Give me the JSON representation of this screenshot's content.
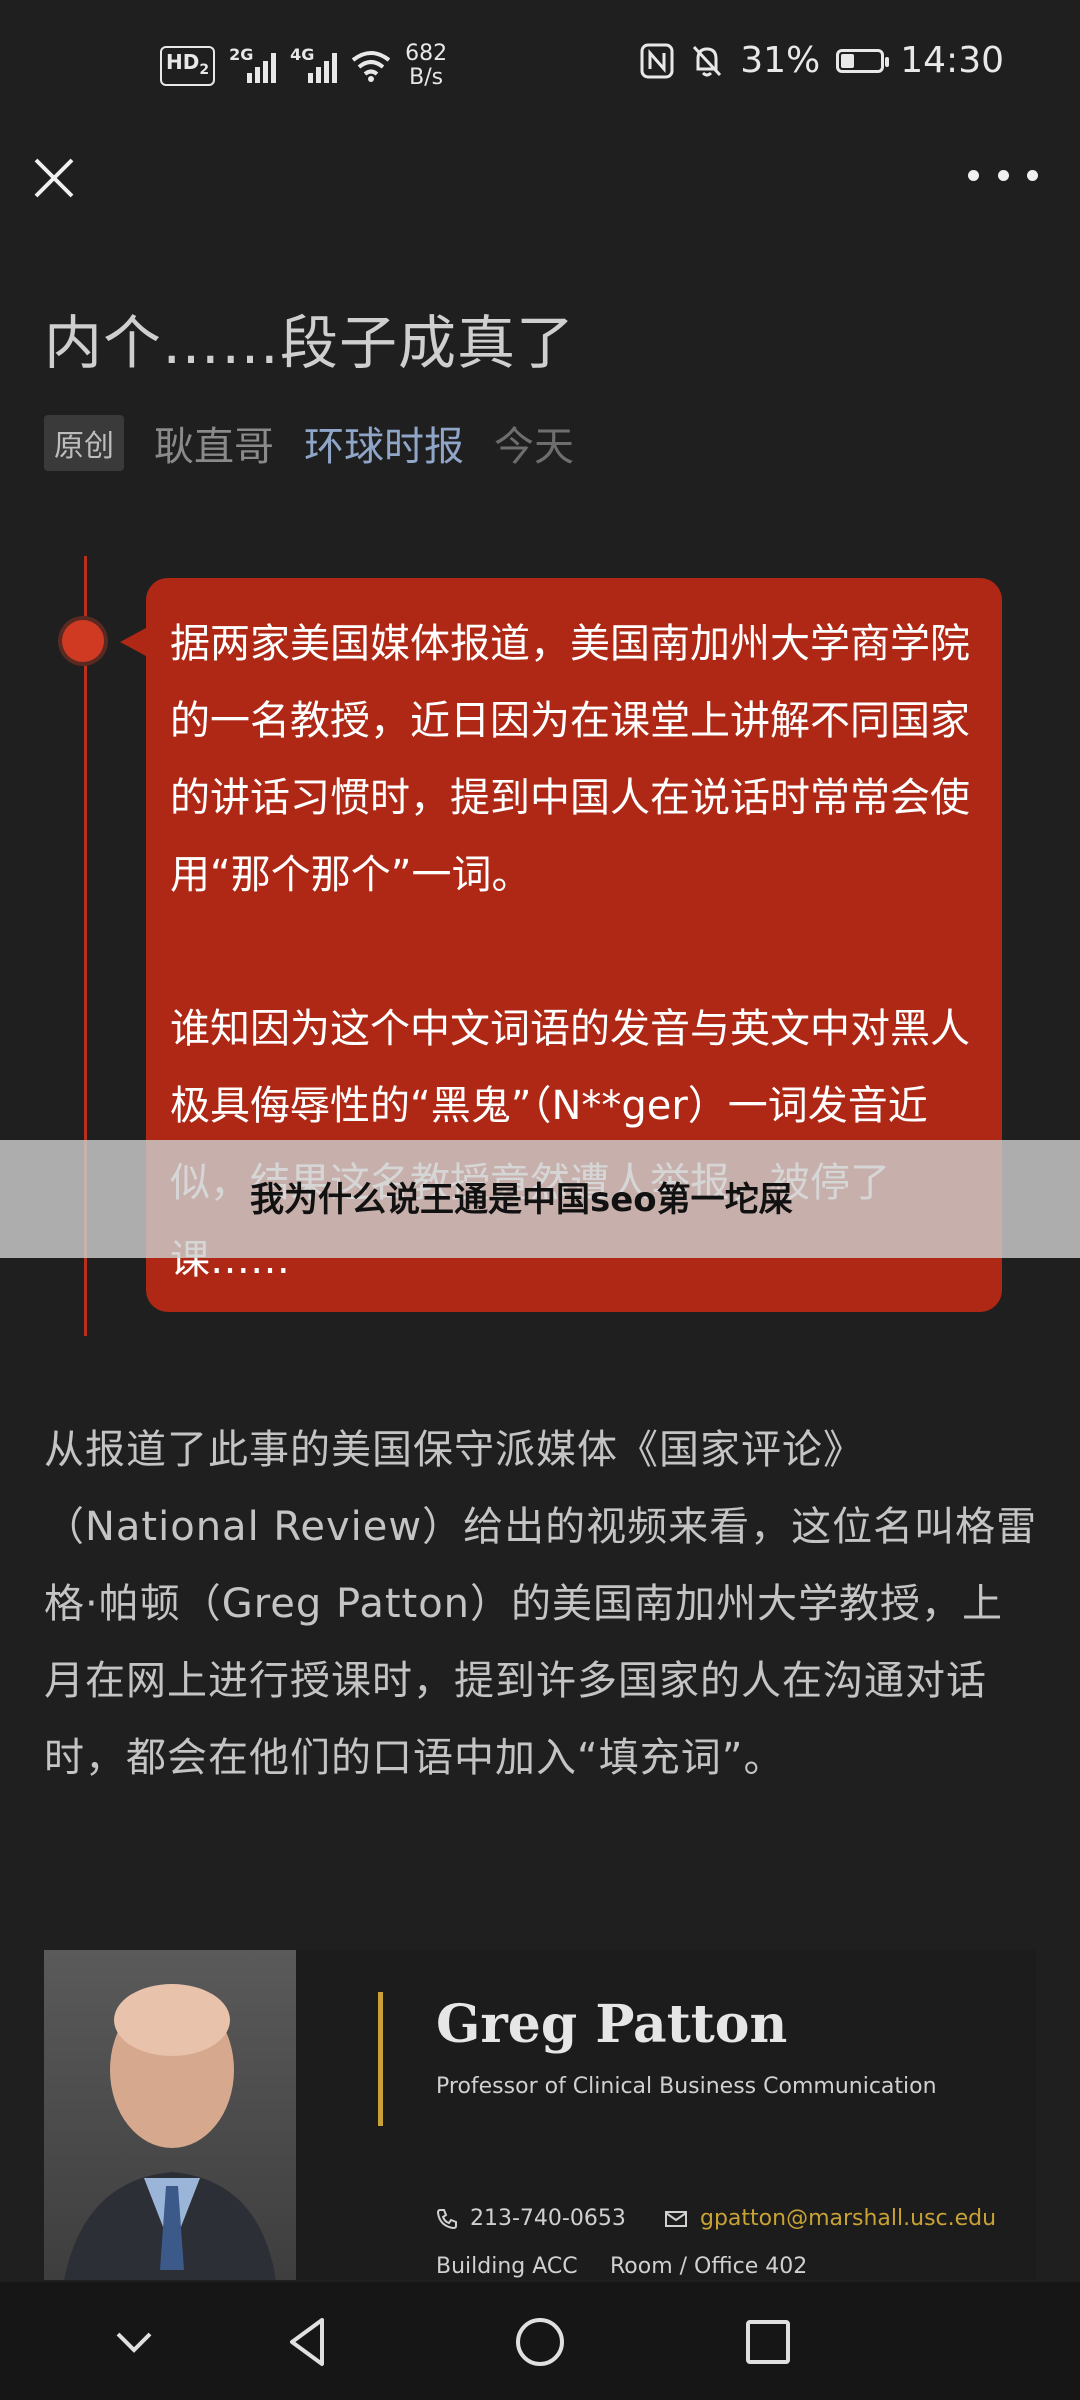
{
  "status_bar": {
    "hd_label": "HD",
    "hd_index": "2",
    "signal1_tag": "2G",
    "signal2_tag": "4G",
    "net_speed_value": "682",
    "net_speed_unit": "B/s",
    "battery_text": "31%",
    "battery_level": 0.31,
    "time": "14:30"
  },
  "article": {
    "title": "内个……段子成真了",
    "original_tag": "原创",
    "author": "耿直哥",
    "account": "环球时报",
    "date": "今天"
  },
  "quote_card": {
    "paragraph1": "据两家美国媒体报道，美国南加州大学商学院的一名教授，近日因为在课堂上讲解不同国家的讲话习惯时，提到中国人在说话时常常会使用“那个那个”一词。",
    "paragraph2": "谁知因为这个中文词语的发音与英文中对黑人极具侮辱性的“黑鬼”（N**ger）一词发音近似，结果这名教授竟然遭人举报，被停了课……"
  },
  "overlay_caption": "我为什么说王通是中国seo第一坨屎",
  "body_paragraph": "从报道了此事的美国保守派媒体《国家评论》（National Review）给出的视频来看，这位名叫格雷格·帕顿（Greg Patton）的美国南加州大学教授，上月在网上进行授课时，提到许多国家的人在沟通对话时，都会在他们的口语中加入“填充词”。",
  "profile_card": {
    "name": "Greg Patton",
    "role": "Professor of Clinical Business Communication",
    "phone": "213-740-0653",
    "email": "gpatton@marshall.usc.edu",
    "building": "Building ACC",
    "room": "Room / Office 402"
  },
  "colors": {
    "background": "#1f1f1f",
    "card_red": "#ae2815",
    "link_blue": "#8fa6c9",
    "gold": "#c8a234"
  },
  "icons": [
    "close-icon",
    "more-icon",
    "phone-icon",
    "mail-icon",
    "nav-collapse-icon",
    "nav-back-icon",
    "nav-home-icon",
    "nav-recents-icon"
  ]
}
